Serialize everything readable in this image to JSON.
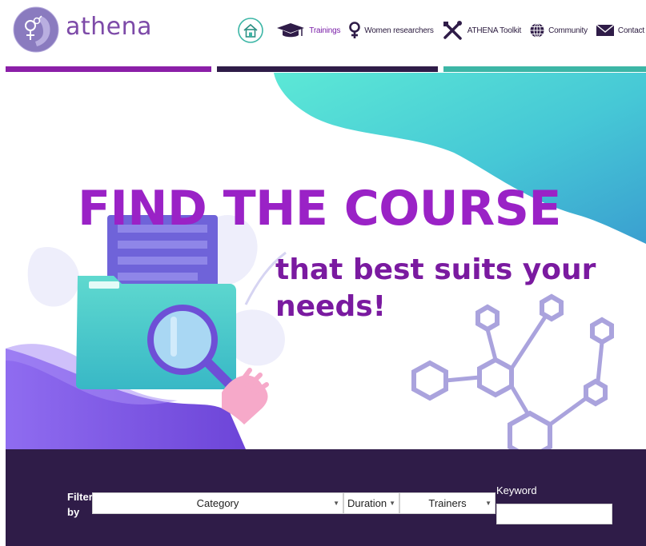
{
  "brand": {
    "name": "athena"
  },
  "nav": [
    {
      "label": "",
      "icon": "home-icon"
    },
    {
      "label": "Trainings",
      "icon": "graduation-cap-icon",
      "active": true
    },
    {
      "label": "Women researchers",
      "icon": "female-symbol-icon"
    },
    {
      "label": "ATHENA Toolkit",
      "icon": "tools-icon"
    },
    {
      "label": "Community",
      "icon": "globe-icon"
    },
    {
      "label": "Contact",
      "icon": "envelope-icon"
    }
  ],
  "colors": {
    "purple": "#7a1fa8",
    "headline": "#9a22c6",
    "dark": "#2f1c48",
    "teal": "#3fbfb0",
    "stripe_1": "#8b1fa8",
    "stripe_2": "#2f1c48",
    "stripe_3": "#3cb6a6"
  },
  "hero": {
    "headline": "FIND THE COURSE",
    "subline": "that best suits your needs!"
  },
  "filters": {
    "label": "Filter by",
    "category": "Category",
    "duration": "Duration",
    "trainers": "Trainers",
    "keyword_label": "Keyword",
    "keyword_value": ""
  }
}
